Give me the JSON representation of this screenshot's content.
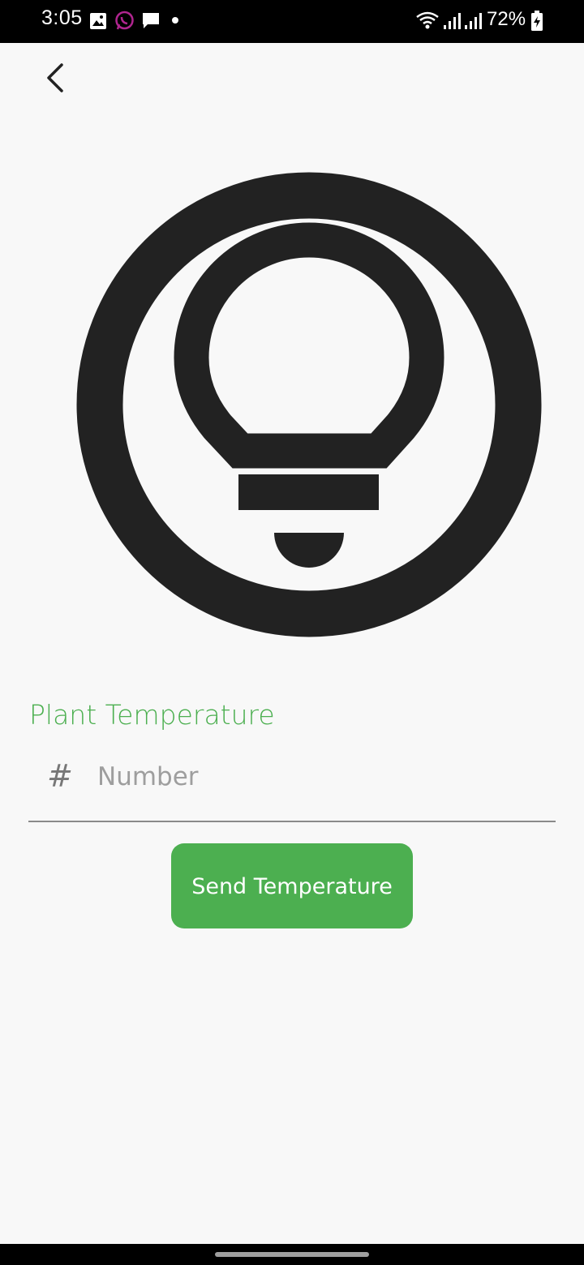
{
  "status_bar": {
    "time": "3:05",
    "battery": "72%",
    "icons": [
      "gallery-icon",
      "whatsapp-icon",
      "message-icon",
      "notification-dot-icon",
      "wifi-icon",
      "signal-icon",
      "signal-icon",
      "battery-charging-icon"
    ]
  },
  "header": {
    "back_icon": "chevron-left-icon"
  },
  "hero": {
    "icon": "lightbulb-circle-icon"
  },
  "form": {
    "label": "Plant Temperature",
    "input_icon": "hash-icon",
    "input_value": "",
    "input_placeholder": "Number",
    "hash_glyph": "#",
    "submit_label": "Send Temperature"
  },
  "colors": {
    "accent": "#4caf50",
    "icon": "#222222",
    "background": "#f8f8f8"
  }
}
